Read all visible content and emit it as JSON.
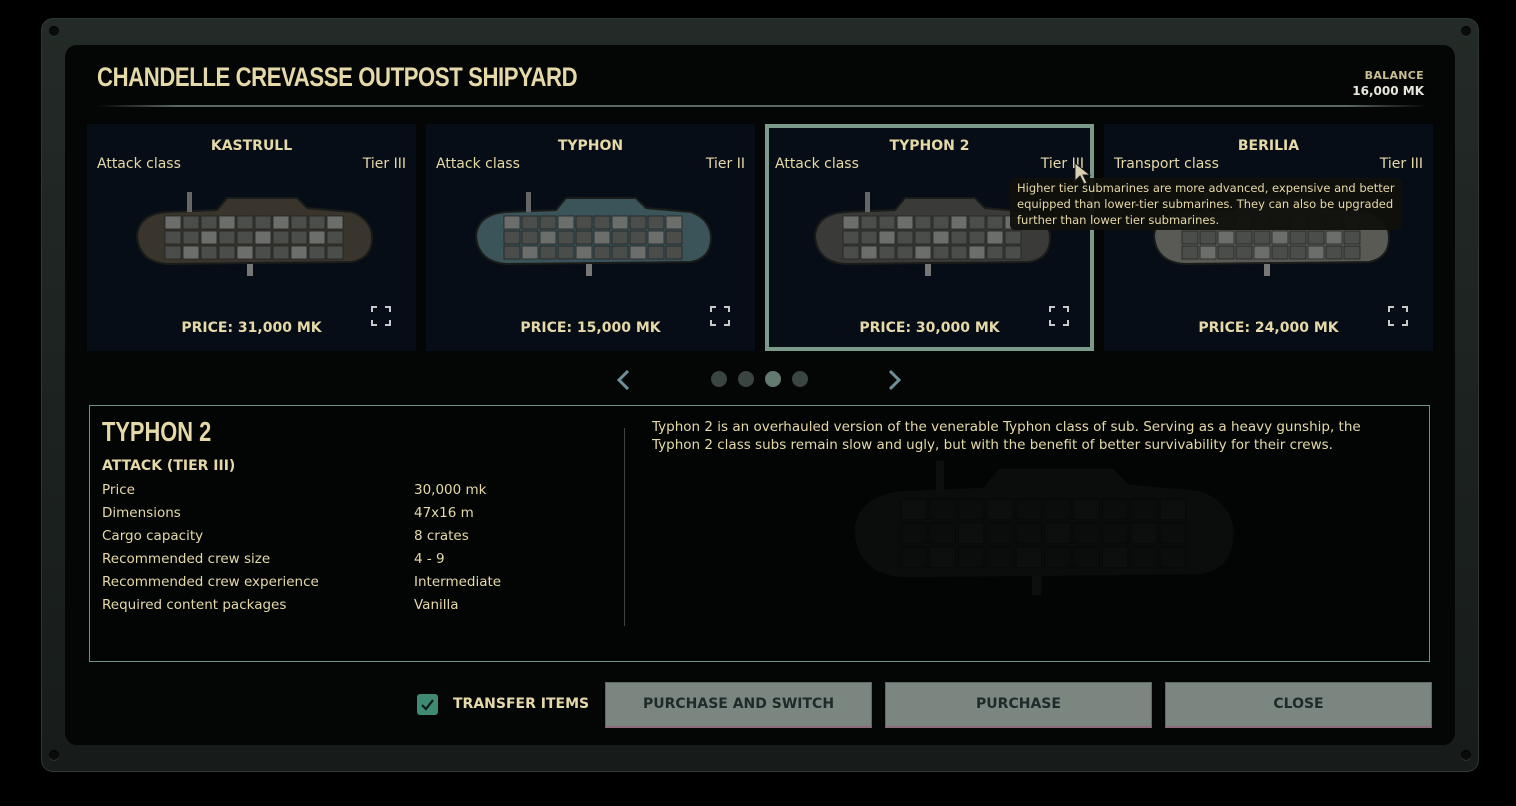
{
  "header": {
    "title": "CHANDELLE CREVASSE OUTPOST SHIPYARD",
    "balance_label": "BALANCE",
    "balance_value": "16,000 MK"
  },
  "cards": [
    {
      "name": "KASTRULL",
      "class": "Attack class",
      "tier": "Tier III",
      "price": "PRICE: 31,000 MK",
      "selected": false,
      "hull_color": "#3a352c"
    },
    {
      "name": "TYPHON",
      "class": "Attack class",
      "tier": "Tier II",
      "price": "PRICE: 15,000 MK",
      "selected": false,
      "hull_color": "#3b5459"
    },
    {
      "name": "TYPHON 2",
      "class": "Attack class",
      "tier": "Tier III",
      "price": "PRICE: 30,000 MK",
      "selected": true,
      "hull_color": "#3a3a38"
    },
    {
      "name": "BERILIA",
      "class": "Transport class",
      "tier": "Tier III",
      "price": "PRICE: 24,000 MK",
      "selected": false,
      "hull_color": "#5a5a55"
    }
  ],
  "pager": {
    "prev_icon": "chevron-left-icon",
    "next_icon": "chevron-right-icon",
    "pages": 4,
    "active_page": 3
  },
  "tooltip": {
    "text": "Higher tier submarines are more advanced, expensive and better equipped than lower-tier submarines. They can also be upgraded further than lower tier submarines."
  },
  "details": {
    "title": "TYPHON 2",
    "subtitle": "ATTACK (TIER III)",
    "specs": [
      {
        "label": "Price",
        "value": "30,000 mk"
      },
      {
        "label": "Dimensions",
        "value": "47x16 m"
      },
      {
        "label": "Cargo capacity",
        "value": "8 crates"
      },
      {
        "label": "Recommended crew size",
        "value": "4 - 9"
      },
      {
        "label": "Recommended crew experience",
        "value": "Intermediate"
      },
      {
        "label": "Required content packages",
        "value": "Vanilla"
      }
    ],
    "description": "Typhon 2 is an overhauled version of the venerable Typhon class of sub. Serving as a heavy gunship, the Typhon 2 class subs remain slow and ugly, but with the benefit of better survivability for their crews."
  },
  "footer": {
    "transfer_items_label": "TRANSFER ITEMS",
    "transfer_items_checked": true,
    "purchase_and_switch_label": "PURCHASE AND SWITCH",
    "purchase_label": "PURCHASE",
    "close_label": "CLOSE"
  },
  "colors": {
    "accent_text": "#e6d9a8",
    "selected_border": "#7b9a89",
    "checkbox": "#3e8a73",
    "button_bg": "#7b8681"
  }
}
